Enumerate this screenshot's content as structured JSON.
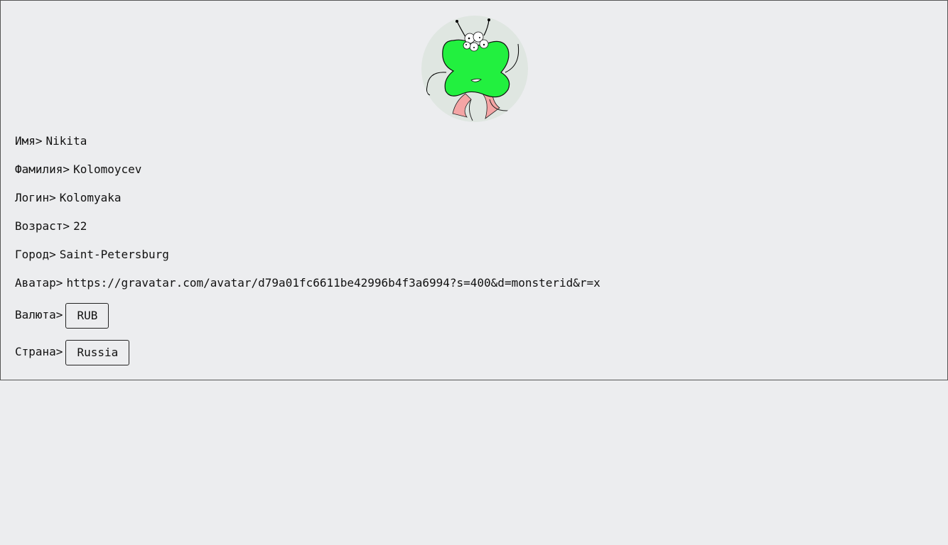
{
  "profile": {
    "fields": {
      "first_name": {
        "label": "Имя>",
        "value": "Nikita"
      },
      "last_name": {
        "label": "Фамилия>",
        "value": "Kolomoycev"
      },
      "login": {
        "label": "Логин>",
        "value": "Kolomyaka"
      },
      "age": {
        "label": "Возраст>",
        "value": "22"
      },
      "city": {
        "label": "Город>",
        "value": "Saint-Petersburg"
      },
      "avatar_url": {
        "label": "Аватар>",
        "value": "https://gravatar.com/avatar/d79a01fc6611be42996b4f3a6994?s=400&d=monsterid&r=x"
      },
      "currency": {
        "label": "Валюта>",
        "value": "RUB"
      },
      "country": {
        "label": "Страна>",
        "value": "Russia"
      }
    },
    "avatar": {
      "icon": "monster-avatar",
      "body_color": "#22f03f",
      "background_color": "#dfe6e1"
    }
  },
  "colors": {
    "page_background": "#ecedef",
    "border": "#555555"
  }
}
